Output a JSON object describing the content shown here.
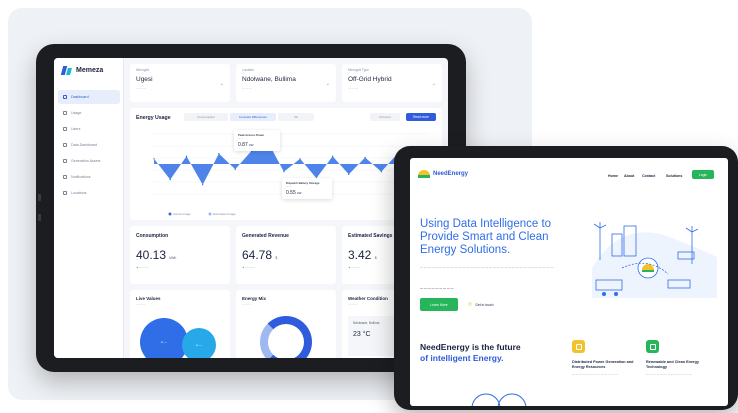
{
  "dashboard": {
    "brand": "Memeza",
    "nav": [
      "Dashboard",
      "Usage",
      "Users",
      "Data Dashboard",
      "Generation Assets",
      "Notifications",
      "Locations"
    ],
    "filters": [
      {
        "label": "Microgrid",
        "value": "Ugesi",
        "sub": ""
      },
      {
        "label": "Location",
        "value": "Ndolwane, Bullima",
        "sub": ""
      },
      {
        "label": "Microgrid Type",
        "value": "Off-Grid Hybrid",
        "sub": ""
      }
    ],
    "energy_usage": {
      "title": "Energy Usage",
      "seg1": "Consumption",
      "seg2": "Forecast Differences",
      "seg3": "All",
      "period": "24 hours",
      "export_button": "Read more",
      "tooltip_peak": {
        "title": "Peak Access Power",
        "value": "0.87",
        "unit": "kW"
      },
      "tooltip_battery": {
        "title": "Dispatch Battery Storage",
        "value": "0.55",
        "unit": "kW"
      },
      "legend": [
        "Actual Usage",
        "Estimated Usage"
      ]
    },
    "stats": [
      {
        "title": "Consumption",
        "value": "40.13",
        "unit": "kWh"
      },
      {
        "title": "Generated Revenue",
        "value": "64.78",
        "unit": "$"
      },
      {
        "title": "Estimated Savings",
        "value": "3.42",
        "unit": "$"
      }
    ],
    "lower": {
      "live_values": "Live Values",
      "energy_mix": "Energy Mix",
      "weather": "Weather Condition",
      "weather_location": "Ndolwane, Bullima",
      "weather_temp": "23 °C"
    }
  },
  "website": {
    "brand": "NeedEnergy",
    "nav": [
      "Home",
      "About",
      "Contact",
      "Solutions"
    ],
    "login": "Login",
    "hero_title": "Using Data Intelligence to Provide Smart and Clean Energy Solutions.",
    "hero_button": "Learn More",
    "hero_touch": "Get in touch",
    "future_title_1": "NeedEnergy is the future",
    "future_title_2": "of intelligent Energy.",
    "features": [
      {
        "title": "Distributed Power Generation and Energy Resources",
        "color": "#f3c12a"
      },
      {
        "title": "Renewable and Clean Energy Technology",
        "color": "#27b55b"
      }
    ]
  },
  "chart_data": {
    "type": "area",
    "title": "Energy Usage",
    "series": [
      {
        "name": "Actual Usage",
        "values": [
          0.2,
          -0.6,
          0.3,
          -0.8,
          0.4,
          -0.2,
          0.5,
          0.87,
          -0.3,
          0.2,
          -0.55,
          0.3,
          -0.4,
          0.25,
          -0.3,
          0.4,
          -0.5,
          0.2
        ]
      }
    ]
  }
}
